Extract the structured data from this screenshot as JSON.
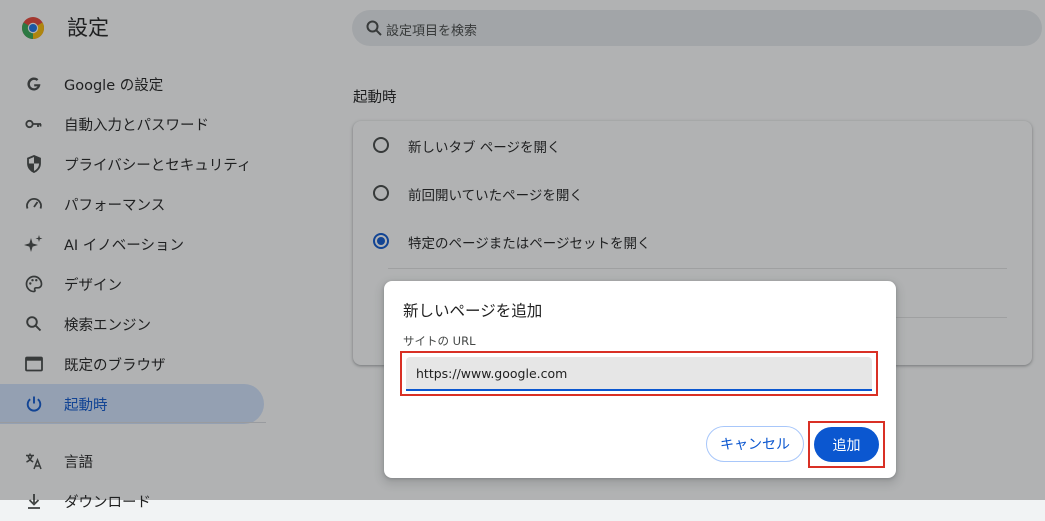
{
  "app": {
    "title": "設定"
  },
  "search": {
    "placeholder": "設定項目を検索"
  },
  "sidebar": {
    "items": [
      {
        "label": "Google の設定",
        "icon": "google-icon"
      },
      {
        "label": "自動入力とパスワード",
        "icon": "key-icon"
      },
      {
        "label": "プライバシーとセキュリティ",
        "icon": "shield-icon"
      },
      {
        "label": "パフォーマンス",
        "icon": "speedometer-icon"
      },
      {
        "label": "AI イノベーション",
        "icon": "sparkle-icon"
      },
      {
        "label": "デザイン",
        "icon": "palette-icon"
      },
      {
        "label": "検索エンジン",
        "icon": "search-icon"
      },
      {
        "label": "既定のブラウザ",
        "icon": "browser-window-icon"
      },
      {
        "label": "起動時",
        "icon": "power-icon",
        "active": true
      },
      {
        "label": "言語",
        "icon": "translate-icon"
      },
      {
        "label": "ダウンロード",
        "icon": "download-icon"
      }
    ]
  },
  "startup": {
    "section_title": "起動時",
    "options": [
      {
        "label": "新しいタブ ページを開く",
        "selected": false
      },
      {
        "label": "前回開いていたページを開く",
        "selected": false
      },
      {
        "label": "特定のページまたはページセットを開く",
        "selected": true
      }
    ]
  },
  "dialog": {
    "title": "新しいページを追加",
    "field_label": "サイトの URL",
    "url_value": "https://www.google.com",
    "cancel_label": "キャンセル",
    "add_label": "追加"
  },
  "colors": {
    "accent": "#0b57d0",
    "active_nav_bg": "#d3e3fd",
    "highlight_box": "#d93025"
  }
}
